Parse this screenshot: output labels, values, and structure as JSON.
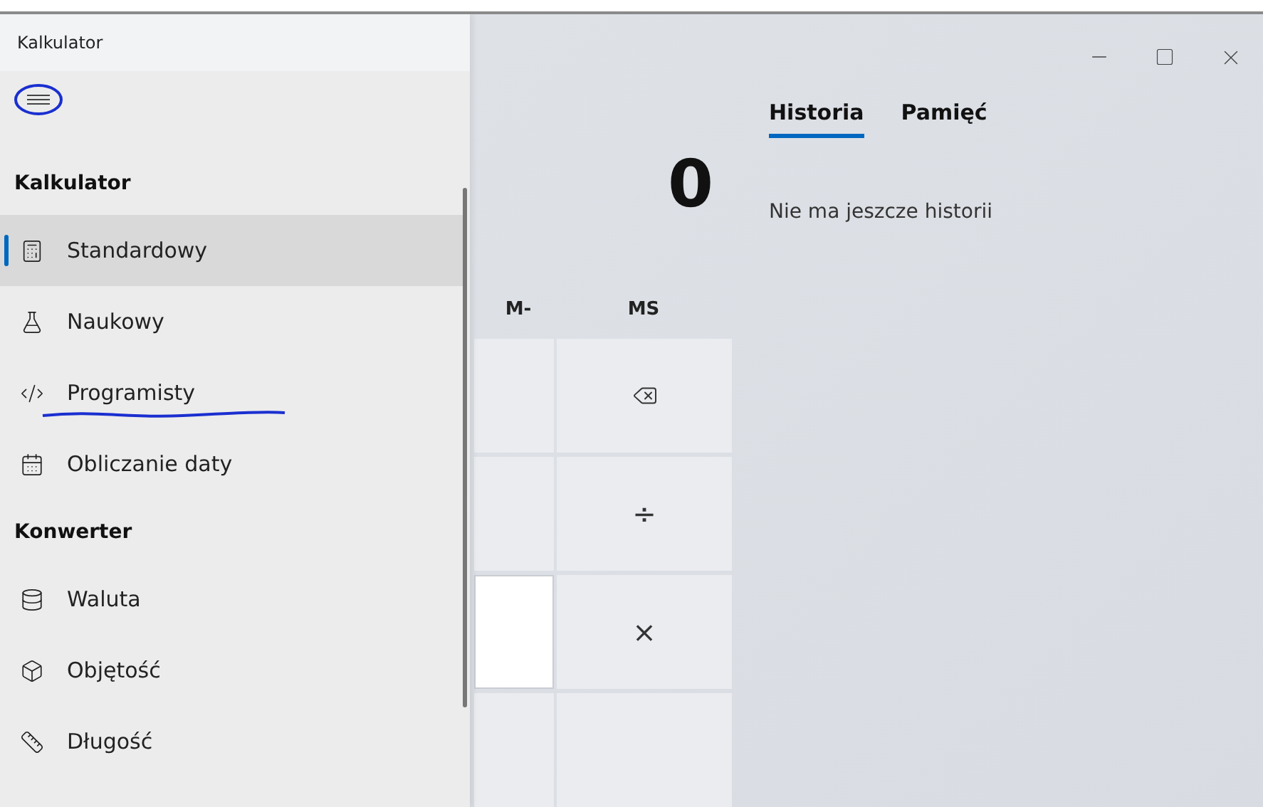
{
  "window": {
    "title": "Kalkulator"
  },
  "nav": {
    "sections": [
      {
        "heading": "Kalkulator",
        "items": [
          {
            "label": "Standardowy",
            "kind": "calculator",
            "selected": true
          },
          {
            "label": "Naukowy",
            "kind": "flask",
            "selected": false
          },
          {
            "label": "Programisty",
            "kind": "code",
            "selected": false,
            "underlined": true
          },
          {
            "label": "Obliczanie daty",
            "kind": "calendar",
            "selected": false
          }
        ]
      },
      {
        "heading": "Konwerter",
        "items": [
          {
            "label": "Waluta",
            "kind": "coins",
            "selected": false
          },
          {
            "label": "Objętość",
            "kind": "cube",
            "selected": false
          },
          {
            "label": "Długość",
            "kind": "ruler",
            "selected": false
          }
        ]
      }
    ]
  },
  "display": {
    "value": "0"
  },
  "memory_buttons": [
    "M-",
    "MS"
  ],
  "keys": [
    {
      "kind": "blank",
      "hovered": false
    },
    {
      "kind": "backspace",
      "hovered": false
    },
    {
      "kind": "blank",
      "hovered": false
    },
    {
      "kind": "text",
      "label": "÷",
      "hovered": false
    },
    {
      "kind": "blank",
      "hovered": true
    },
    {
      "kind": "text",
      "label": "×",
      "hovered": false
    },
    {
      "kind": "blank",
      "hovered": false
    },
    {
      "kind": "blank",
      "hovered": false
    }
  ],
  "tabs": [
    {
      "label": "Historia",
      "selected": true
    },
    {
      "label": "Pamięć",
      "selected": false
    }
  ],
  "history": {
    "empty_text": "Nie ma jeszcze historii"
  }
}
